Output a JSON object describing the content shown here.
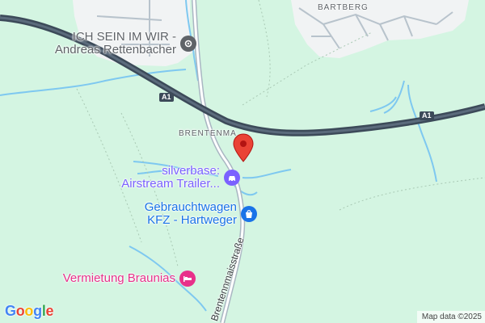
{
  "map": {
    "place_labels": {
      "bartberg": "BARTBERG",
      "brentenmais": "BRENTENMA"
    },
    "highway_shield": "A1",
    "street_name": "Brentennmaisstraße",
    "pois": [
      {
        "line1": "ICH SEIN IM WIR -",
        "line2": "Andreas Rettenbacher",
        "icon": "gray-poi-icon",
        "color": "#5f6368"
      },
      {
        "line1": "silverbase:",
        "line2": "Airstream Trailer...",
        "icon": "car-icon",
        "color": "#7b61ff"
      },
      {
        "line1": "Gebrauchtwagen",
        "line2": "KFZ - Hartweger",
        "icon": "shopping-bag-icon",
        "color": "#1a73e8"
      },
      {
        "line1": "Vermietung Braunias",
        "line2": "",
        "icon": "bed-icon",
        "color": "#e8308a"
      }
    ],
    "pin": {
      "icon": "location-pin-icon",
      "color": "#ea4335"
    },
    "logo": {
      "letters": [
        "G",
        "o",
        "o",
        "g",
        "l",
        "e"
      ],
      "colors": [
        "#4285f4",
        "#ea4335",
        "#fbbc05",
        "#4285f4",
        "#34a853",
        "#ea4335"
      ]
    },
    "attribution": "Map data ©2025",
    "colors": {
      "forest": "#d4f5e2",
      "settlement": "#f1f3f4",
      "highway": "#3c4a59",
      "water": "#7ec8f0",
      "road": "#a9b6c2"
    }
  }
}
